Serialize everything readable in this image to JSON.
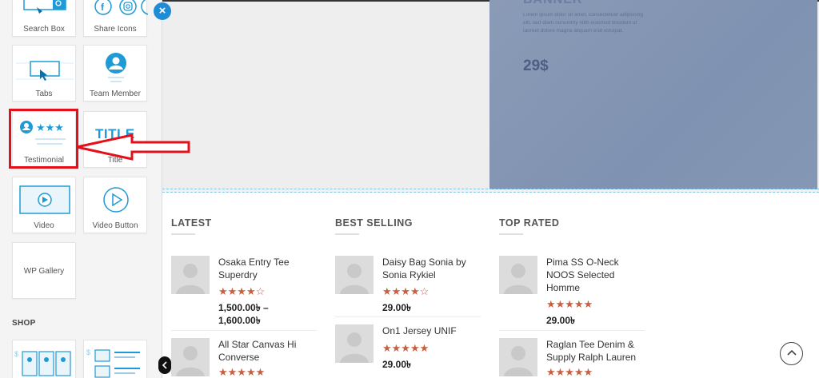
{
  "panel": {
    "tiles": [
      {
        "label": "Search Box"
      },
      {
        "label": "Share Icons"
      },
      {
        "label": "Tabs"
      },
      {
        "label": "Team Member"
      },
      {
        "label": "Testimonial"
      },
      {
        "label": "Title",
        "icon_text": "TITLE"
      },
      {
        "label": "Video"
      },
      {
        "label": "Video Button"
      },
      {
        "label": "WP Gallery"
      }
    ],
    "section_title": "SHOP",
    "close_glyph": "×"
  },
  "banner": {
    "title": "BANNER",
    "text": "Lorem ipsum dolor sit amet, consectetuer adipiscing elit, sed diam nonummy nibh euismod tincidunt ut laoreet dolore magna aliquam erat volutpat.",
    "price": "29$"
  },
  "columns": [
    {
      "title": "LATEST",
      "items": [
        {
          "name": "Osaka Entry Tee Superdry",
          "stars": "★★★★☆",
          "price": "1,500.00৳ – 1,600.00৳"
        },
        {
          "name": "All Star Canvas Hi Converse",
          "stars": "★★★★★",
          "price": ""
        }
      ]
    },
    {
      "title": "BEST SELLING",
      "items": [
        {
          "name": "Daisy Bag Sonia by Sonia Rykiel",
          "stars": "★★★★☆",
          "price": "29.00৳"
        },
        {
          "name": "On1 Jersey UNIF",
          "stars": "★★★★★",
          "price": "29.00৳"
        }
      ]
    },
    {
      "title": "TOP RATED",
      "items": [
        {
          "name": "Pima SS O-Neck NOOS Selected Homme",
          "stars": "★★★★★",
          "price": "29.00৳"
        },
        {
          "name": "Raglan Tee Denim & Supply Ralph Lauren",
          "stars": "★★★★★",
          "price": ""
        }
      ]
    }
  ],
  "colors": {
    "accent": "#1f8dd6",
    "star": "#c8603f",
    "highlight": "#e3101b",
    "banner": "#8a9bb6"
  },
  "back_to_top_icon": "chevron-up-icon"
}
